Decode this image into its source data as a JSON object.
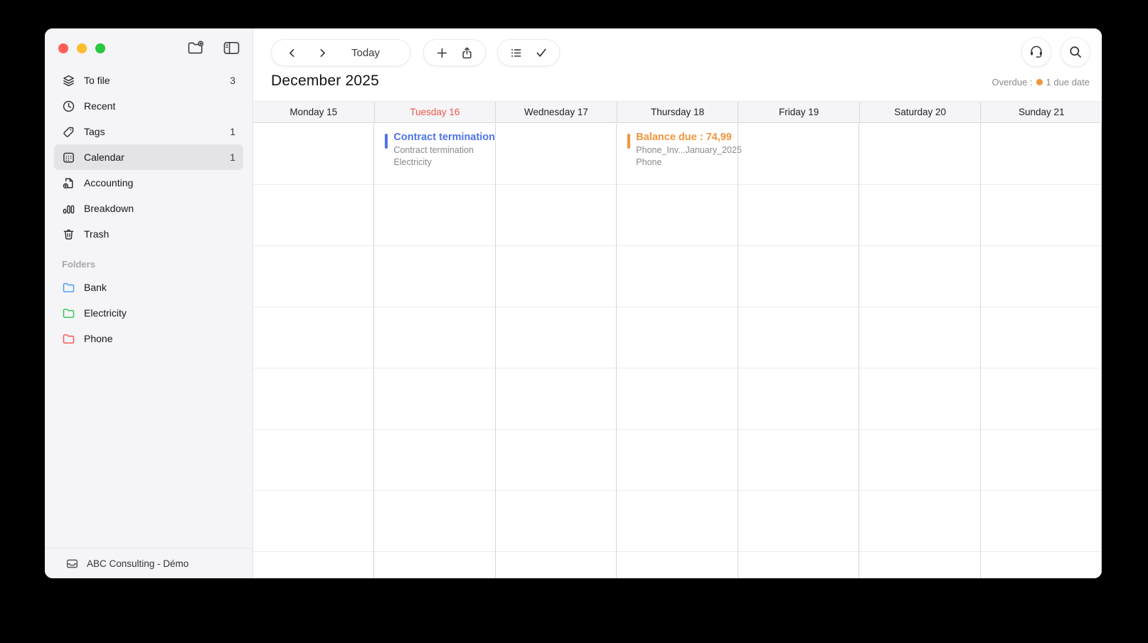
{
  "colors": {
    "accent_blue": "#4f74e8",
    "accent_orange": "#f0963d",
    "today_red": "#f2544d",
    "traffic_red": "#ff5f57",
    "traffic_yellow": "#febc2e",
    "traffic_green": "#28c840"
  },
  "sidebar": {
    "items": [
      {
        "label": "To file",
        "count": "3",
        "icon": "layers-icon",
        "selected": false
      },
      {
        "label": "Recent",
        "count": "",
        "icon": "clock-icon",
        "selected": false
      },
      {
        "label": "Tags",
        "count": "1",
        "icon": "tag-icon",
        "selected": false
      },
      {
        "label": "Calendar",
        "count": "1",
        "icon": "calendar-icon",
        "selected": true
      },
      {
        "label": "Accounting",
        "count": "",
        "icon": "document-upload-icon",
        "selected": false
      },
      {
        "label": "Breakdown",
        "count": "",
        "icon": "bar-chart-icon",
        "selected": false
      },
      {
        "label": "Trash",
        "count": "",
        "icon": "trash-icon",
        "selected": false
      }
    ],
    "folders_header": "Folders",
    "folders": [
      {
        "label": "Bank",
        "color": "#3e9bfd"
      },
      {
        "label": "Electricity",
        "color": "#30c454"
      },
      {
        "label": "Phone",
        "color": "#f5544d"
      }
    ],
    "footer_label": "ABC Consulting - Démo"
  },
  "toolbar": {
    "today_label": "Today"
  },
  "header": {
    "month_title": "December 2025",
    "overdue_prefix": "Overdue :",
    "overdue_text": "1 due date"
  },
  "calendar": {
    "days": [
      {
        "label": "Monday 15",
        "today": false
      },
      {
        "label": "Tuesday 16",
        "today": true
      },
      {
        "label": "Wednesday 17",
        "today": false
      },
      {
        "label": "Thursday 18",
        "today": false
      },
      {
        "label": "Friday 19",
        "today": false
      },
      {
        "label": "Saturday 20",
        "today": false
      },
      {
        "label": "Sunday 21",
        "today": false
      }
    ],
    "events": [
      {
        "day_index": 1,
        "title": "Contract termination",
        "line1": "Contract termination",
        "line2": "Electricity",
        "color": "#4f74e8"
      },
      {
        "day_index": 3,
        "title": "Balance due : 74,99",
        "line1": "Phone_Inv...January_2025",
        "line2": "Phone",
        "color": "#f0963d"
      }
    ]
  }
}
